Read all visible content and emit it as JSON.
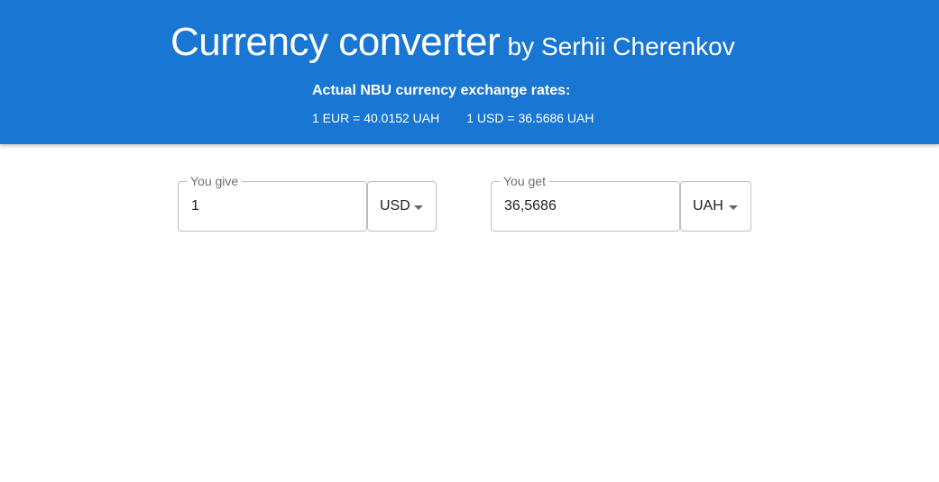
{
  "header": {
    "title": "Currency converter",
    "subtitle": "by Serhii Cherenkov",
    "rates_heading": "Actual NBU currency exchange rates:",
    "rates": [
      "1 EUR = 40.0152 UAH",
      "1 USD = 36.5686 UAH"
    ],
    "background_color": "#1976d2"
  },
  "converter": {
    "give": {
      "label": "You give",
      "value": "1",
      "currency": "USD"
    },
    "get": {
      "label": "You get",
      "value": "36,5686",
      "currency": "UAH"
    }
  },
  "icons": {
    "dropdown": "caret-down-icon"
  }
}
